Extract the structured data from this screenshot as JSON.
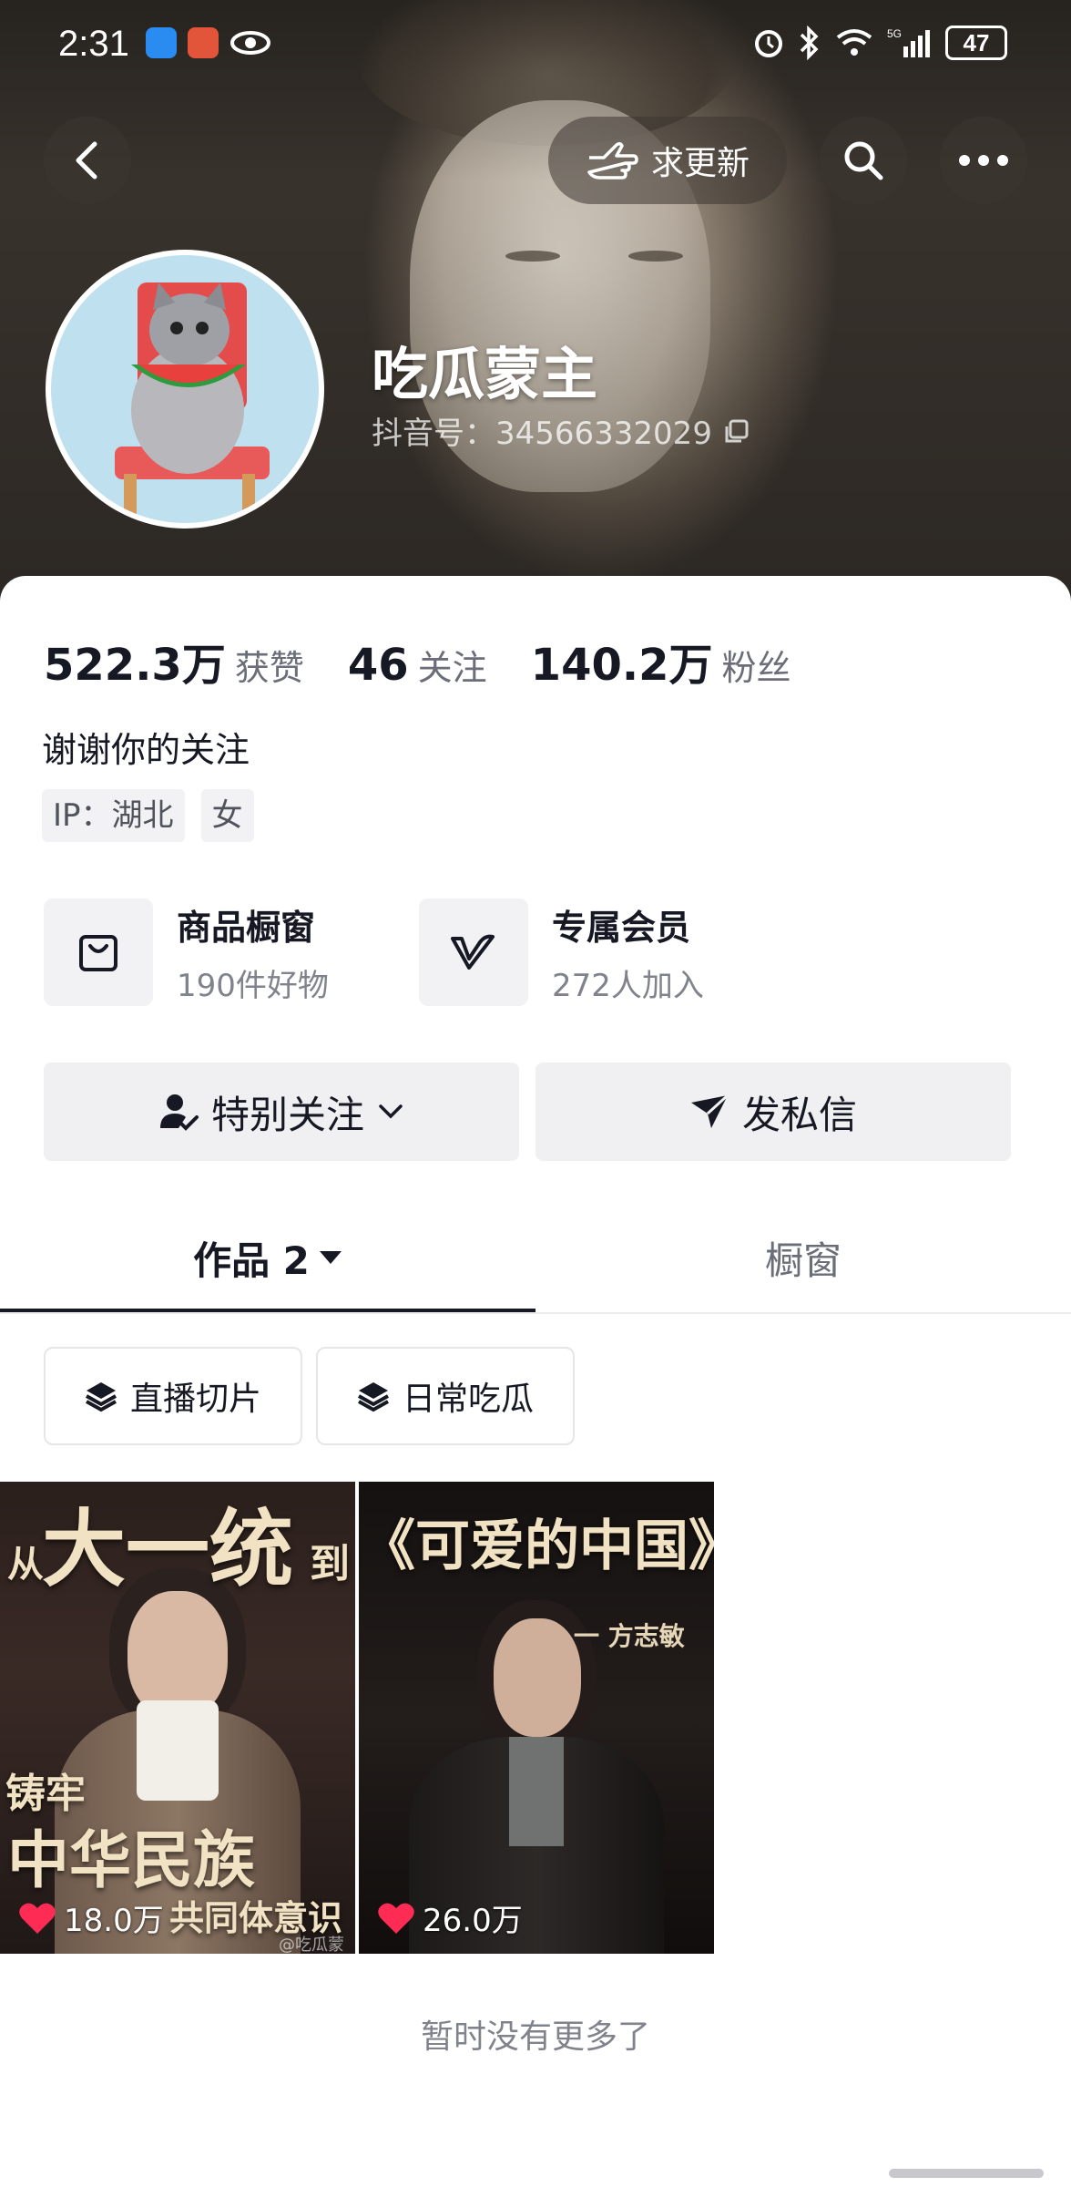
{
  "status_bar": {
    "time": "2:31",
    "battery": "47"
  },
  "header": {
    "request_update_label": "求更新"
  },
  "profile": {
    "name": "吃瓜蒙主",
    "douyin_id": "抖音号：34566332029",
    "likes_count": "522.3万",
    "likes_label": "获赞",
    "following_count": "46",
    "following_label": "关注",
    "followers_count": "140.2万",
    "followers_label": "粉丝",
    "bio": "谢谢你的关注",
    "tags": [
      "IP：湖北",
      "女"
    ]
  },
  "services": [
    {
      "title": "商品橱窗",
      "subtitle": "190件好物",
      "icon": "shopping-bag-icon"
    },
    {
      "title": "专属会员",
      "subtitle": "272人加入",
      "icon": "v-member-icon"
    }
  ],
  "actions": {
    "follow_label": "特别关注",
    "message_label": "发私信"
  },
  "tabs": [
    {
      "label": "作品 2",
      "active": true
    },
    {
      "label": "橱窗",
      "active": false
    }
  ],
  "collections": [
    "直播切片",
    "日常吃瓜"
  ],
  "videos": [
    {
      "likes": "18.0万",
      "top_text_small": "从",
      "top_text_big": "大一统",
      "top_text_end": "到",
      "mid_text": "铸牢",
      "bottom_text": "中华民族",
      "bottom_text2": "共同体意识",
      "watermark": "@吃瓜蒙主"
    },
    {
      "likes": "26.0万",
      "top_text_big": "《可爱的中国》",
      "byline": "一 方志敏"
    }
  ],
  "footer_text": "暂时没有更多了",
  "colors": {
    "accent": "#fe2c55",
    "tab_indicator": "#161823"
  }
}
